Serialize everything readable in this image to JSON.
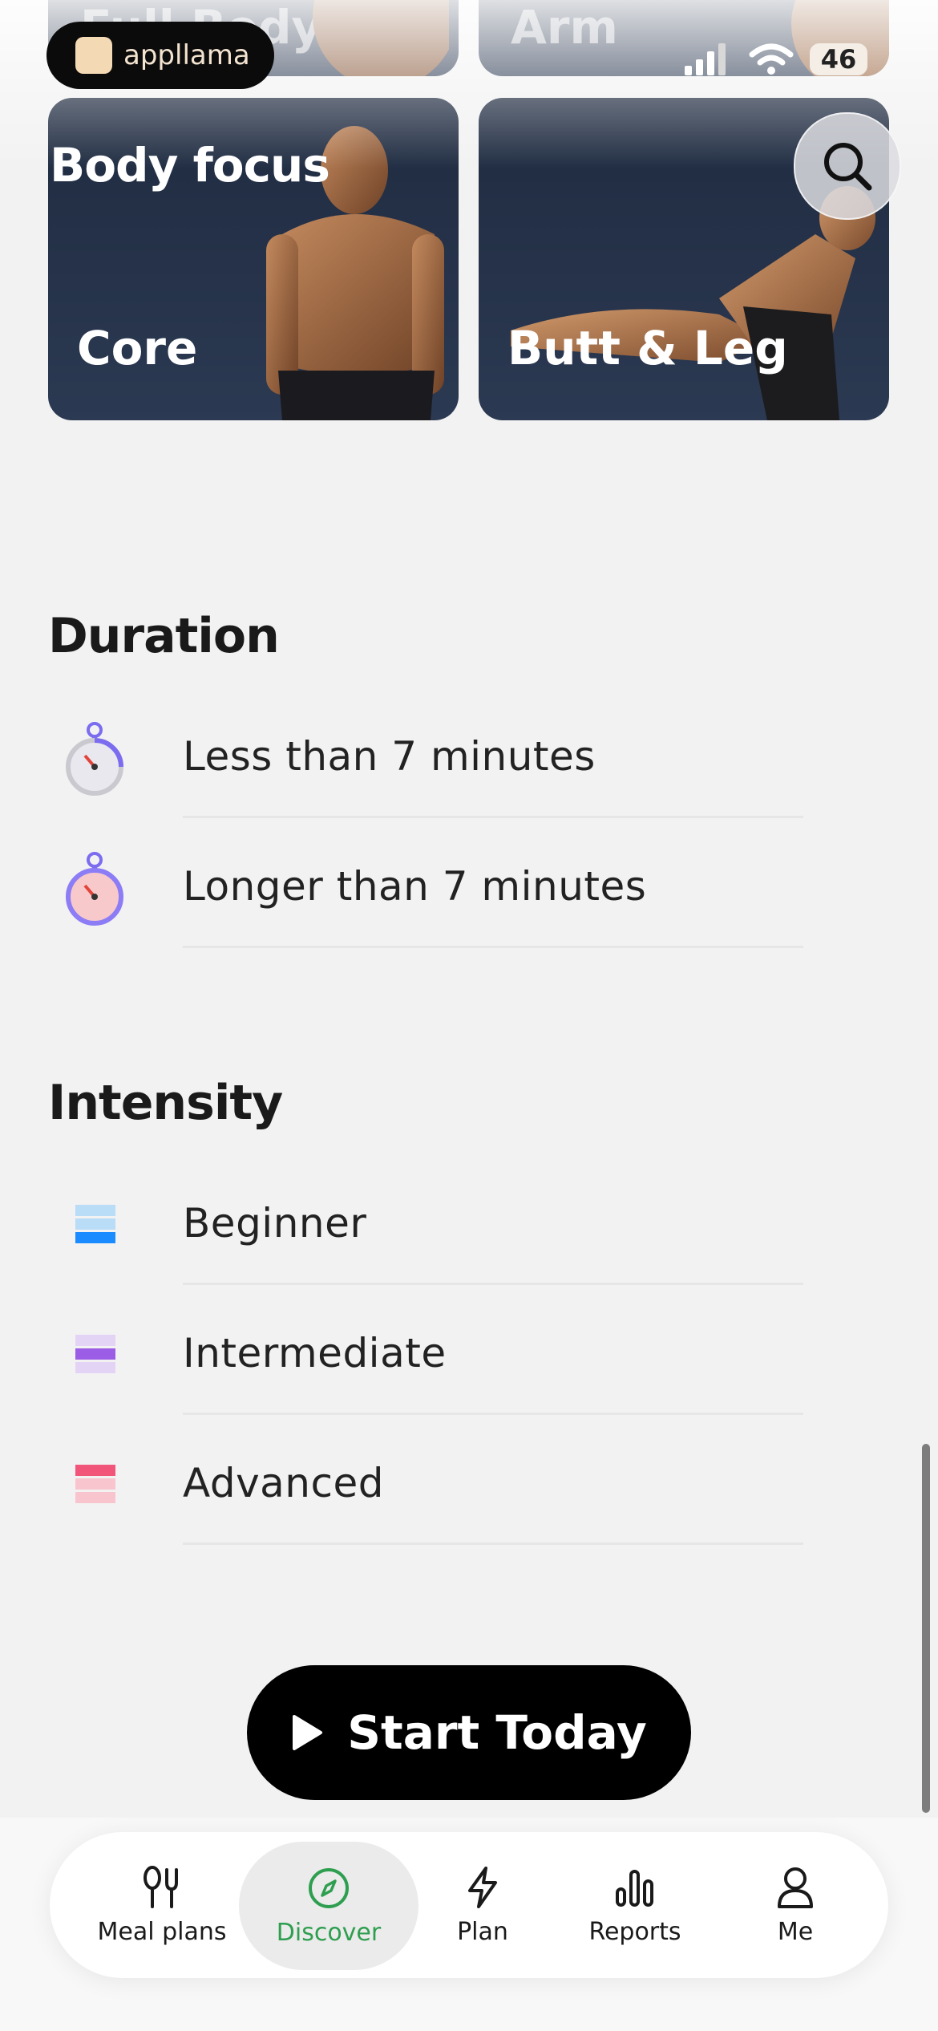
{
  "status_bar": {
    "app_badge": "appllama",
    "battery": "46"
  },
  "top_cards": [
    {
      "label": "Full Body"
    },
    {
      "label": "Arm"
    }
  ],
  "body_focus": {
    "title": "Body focus",
    "cards": [
      {
        "label": "Core"
      },
      {
        "label": "Butt & Leg"
      }
    ]
  },
  "duration": {
    "title": "Duration",
    "items": [
      {
        "label": "Less than 7 minutes",
        "icon": "stopwatch-gray-icon"
      },
      {
        "label": "Longer than 7 minutes",
        "icon": "stopwatch-purple-icon"
      }
    ]
  },
  "intensity": {
    "title": "Intensity",
    "items": [
      {
        "label": "Beginner",
        "icon": "intensity-low-icon",
        "color": "#1a8cff"
      },
      {
        "label": "Intermediate",
        "icon": "intensity-mid-icon",
        "color": "#9b5de5"
      },
      {
        "label": "Advanced",
        "icon": "intensity-high-icon",
        "color": "#f2557a"
      }
    ]
  },
  "cta": {
    "label": "Start Today"
  },
  "tabbar": {
    "items": [
      {
        "label": "Meal plans",
        "icon": "meal-plans-icon"
      },
      {
        "label": "Discover",
        "icon": "compass-icon",
        "active": true
      },
      {
        "label": "Plan",
        "icon": "lightning-icon"
      },
      {
        "label": "Reports",
        "icon": "bar-chart-icon"
      },
      {
        "label": "Me",
        "icon": "person-icon"
      }
    ]
  },
  "colors": {
    "active_tab": "#2e9e4f",
    "card_bg": "#243149",
    "cta_bg": "#000000"
  }
}
